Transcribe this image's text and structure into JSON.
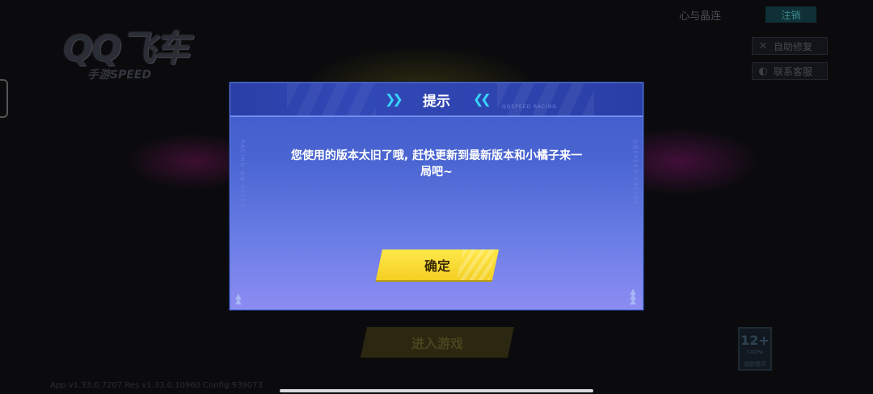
{
  "background": {
    "logo_text": "QQ飞车",
    "logo_subtext": "手游SPEED",
    "account_name": "心与晶连",
    "logout_label": "注销",
    "side_links": [
      {
        "label": "自助修复",
        "icon": "wrench-icon"
      },
      {
        "label": "联系客服",
        "icon": "headset-icon"
      }
    ],
    "enter_game_label": "进入游戏",
    "age_rating": "12+",
    "age_rating_org": "CADPA",
    "age_rating_tip": "适龄提示",
    "version_info": "App v1.33.0.7207 Res v1.33.0.10960 Config:939073"
  },
  "dialog": {
    "title": "提示",
    "message_line1": "您使用的版本太旧了哦, 赶快更新到最新版本和小橘子来一",
    "message_line2": "局吧~",
    "confirm_label": "确定",
    "header_tag": "QQSPEED RACING",
    "side_text_left": "RACING QQ SPEED",
    "side_text_right": "QQSPEED RACING"
  },
  "colors": {
    "dialog_top": "#3f58c9",
    "dialog_bottom": "#8c8cf2",
    "confirm_button": "#f4cf22",
    "accent_chevron": "#39d3ff"
  }
}
